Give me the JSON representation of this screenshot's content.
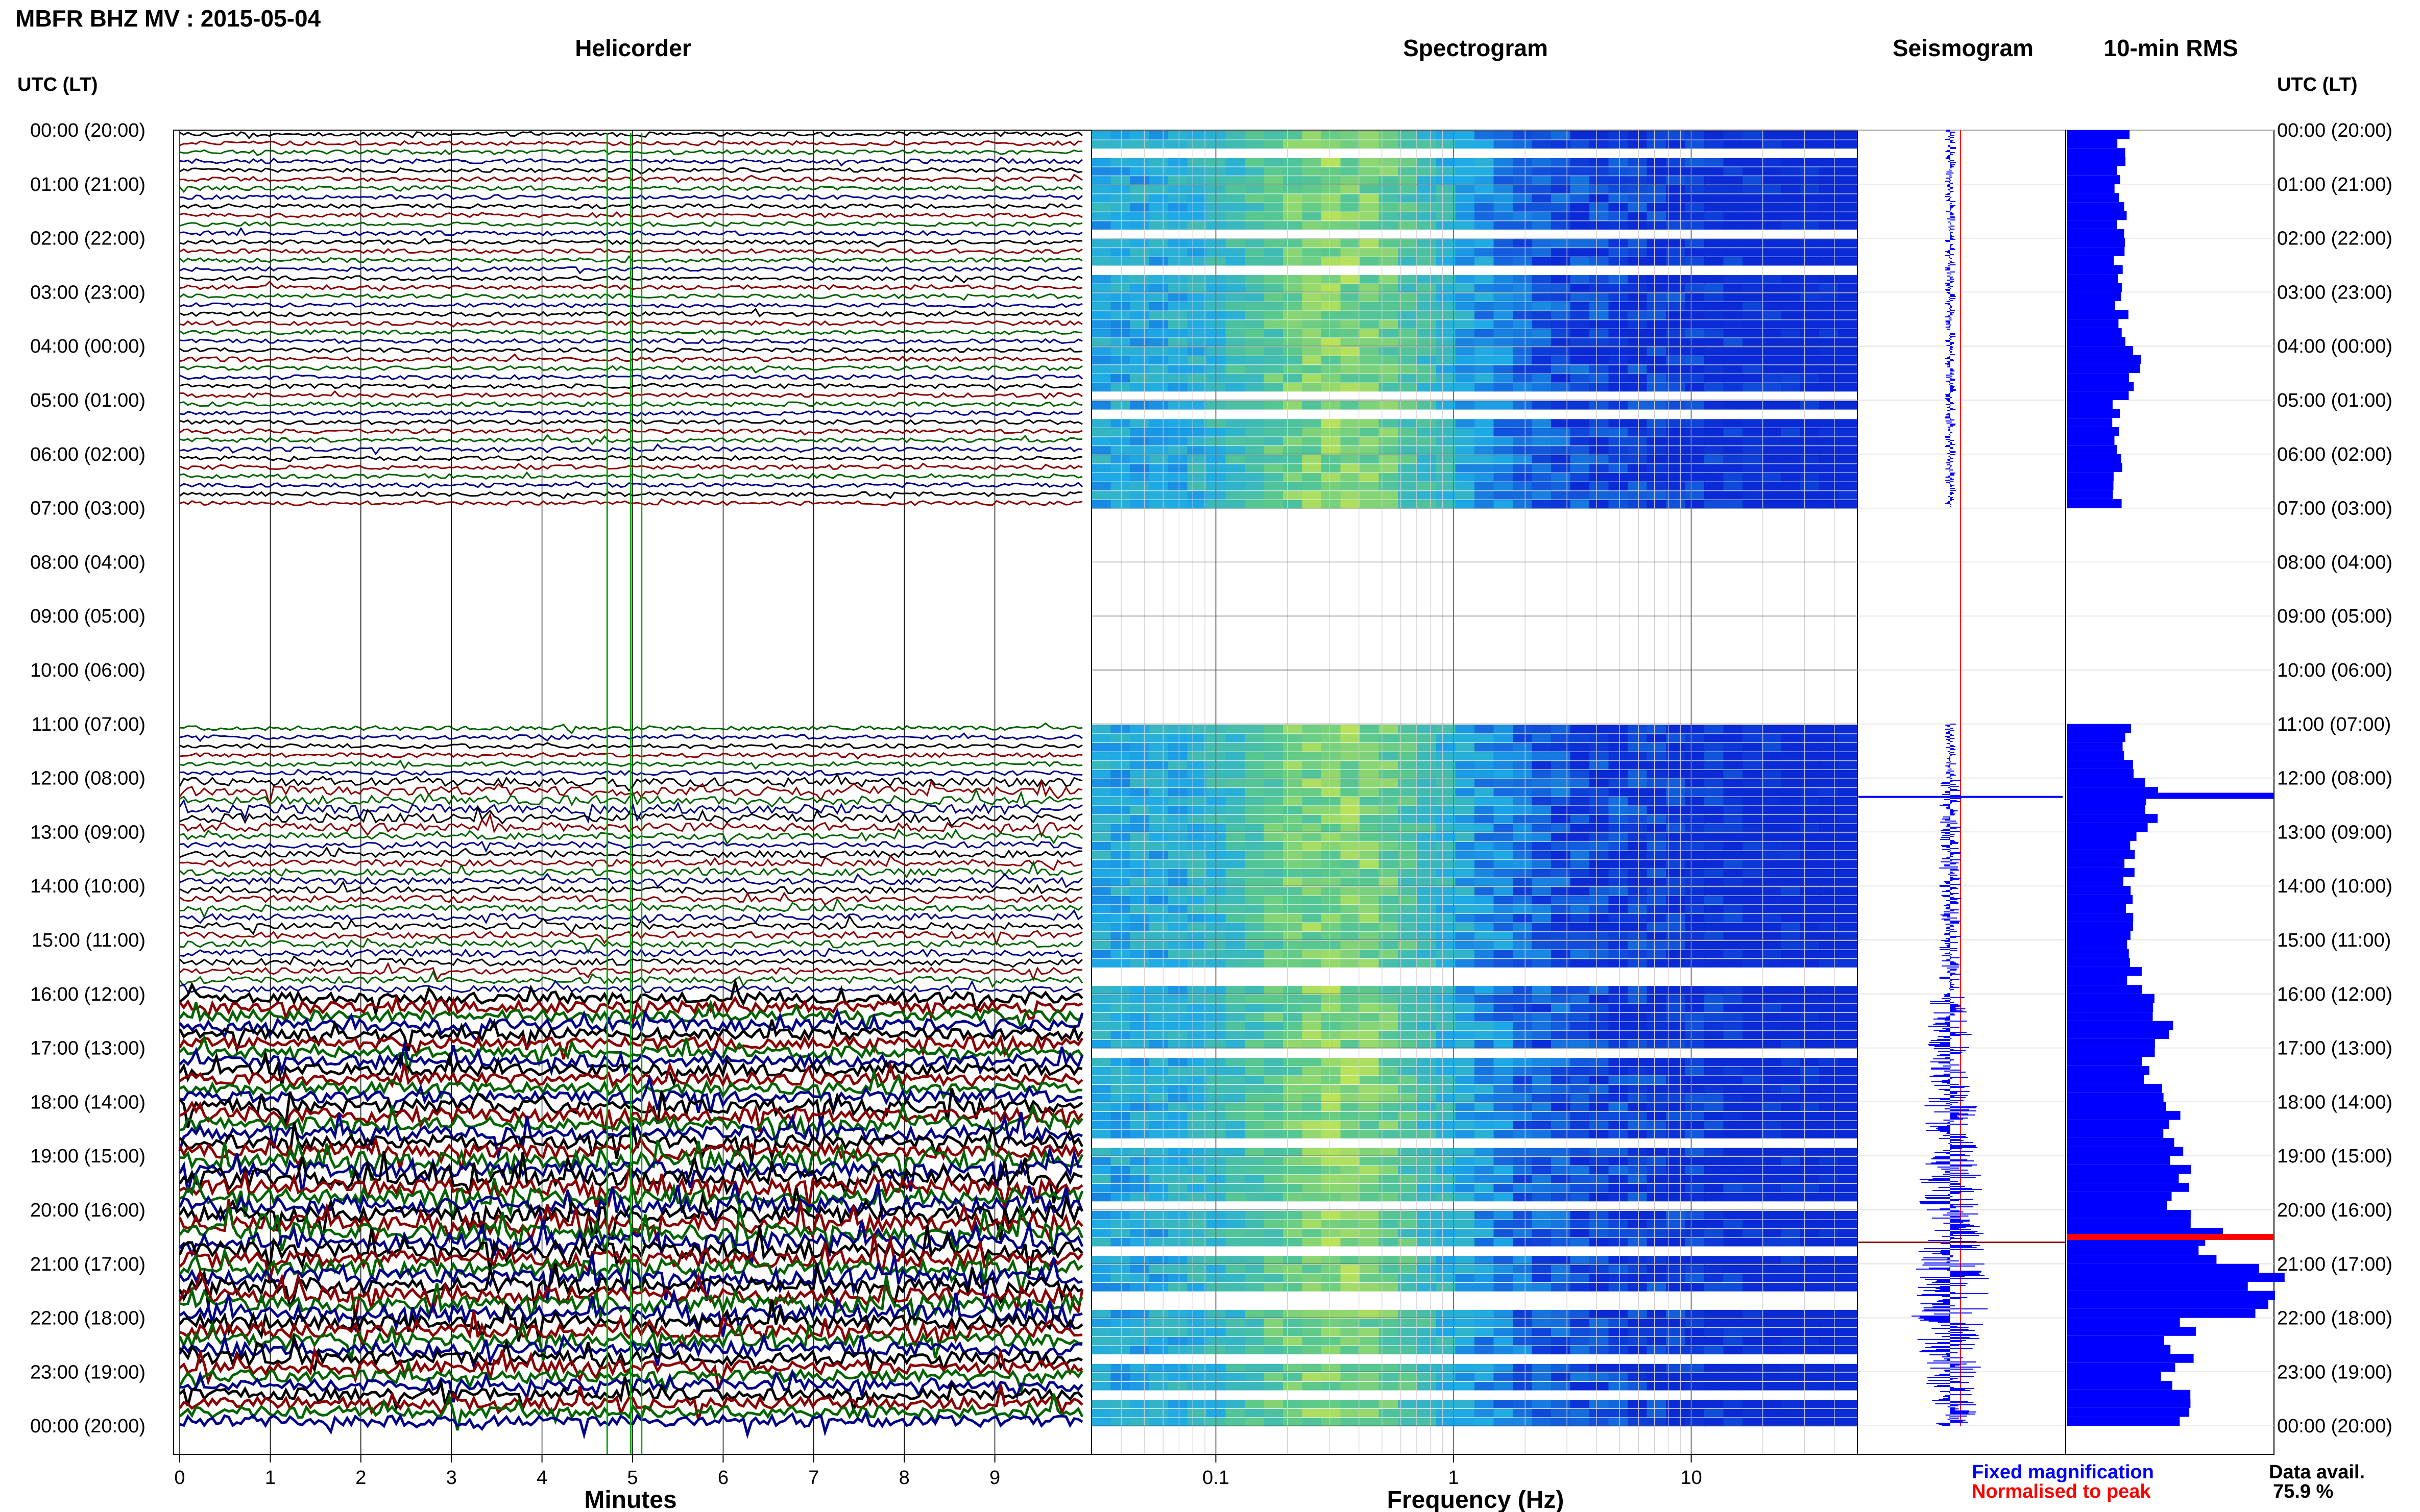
{
  "header": {
    "title": "MBFR BHZ MV : 2015-05-04"
  },
  "panels": {
    "helicorder": "Helicorder",
    "spectrogram": "Spectrogram",
    "seismogram": "Seismogram",
    "rms": "10-min RMS"
  },
  "axis_labels": {
    "time_left": "UTC (LT)",
    "time_right": "UTC (LT)",
    "minutes": "Minutes",
    "frequency": "Frequency (Hz)"
  },
  "legend": {
    "fixed": "Fixed magnification",
    "normalised": "Normalised to peak",
    "availability_label": "Data avail.",
    "availability_value": "75.9 %"
  },
  "colors": {
    "fixed": "#0000ff",
    "normalised": "#ff0000",
    "trace_colors": [
      "#000000",
      "#8b0000",
      "#006400",
      "#00008b"
    ],
    "spectro_low": "#0a2ad6",
    "spectro_high": "#f2f23c"
  },
  "chart_data": [
    {
      "type": "line",
      "panel": "Helicorder",
      "xlabel": "Minutes",
      "x_ticks": [
        "0",
        "1",
        "2",
        "3",
        "4",
        "5",
        "6",
        "7",
        "8",
        "9"
      ],
      "xlim": [
        0,
        10
      ],
      "y_ticks": [
        "00:00 (20:00)",
        "01:00 (21:00)",
        "02:00 (22:00)",
        "03:00 (23:00)",
        "04:00 (00:00)",
        "05:00 (01:00)",
        "06:00 (02:00)",
        "07:00 (03:00)",
        "08:00 (04:00)",
        "09:00 (05:00)",
        "10:00 (06:00)",
        "11:00 (07:00)",
        "12:00 (08:00)",
        "13:00 (09:00)",
        "14:00 (10:00)",
        "15:00 (11:00)",
        "16:00 (12:00)",
        "17:00 (13:00)",
        "18:00 (14:00)",
        "19:00 (15:00)",
        "20:00 (16:00)",
        "21:00 (17:00)",
        "22:00 (18:00)",
        "23:00 (19:00)",
        "00:00 (20:00)"
      ],
      "data_gap_hours": [
        7,
        11
      ],
      "amplitude_by_hour": [
        1,
        1,
        1,
        1,
        1,
        1,
        1,
        0,
        0,
        0,
        0,
        1,
        3,
        2,
        2,
        2,
        4,
        4,
        5,
        6,
        6,
        6,
        5,
        4
      ]
    },
    {
      "type": "heatmap",
      "panel": "Spectrogram",
      "xlabel": "Frequency (Hz)",
      "x_scale": "log",
      "x_ticks": [
        "0.1",
        "1",
        "10"
      ],
      "xlim": [
        0.03,
        50
      ],
      "peak_band_hz": [
        0.2,
        0.5
      ],
      "data_gap_hours": [
        7,
        11
      ]
    },
    {
      "type": "line",
      "panel": "Seismogram",
      "envelope_by_hour": [
        1,
        1,
        1,
        1,
        1,
        1,
        1,
        0,
        0,
        0,
        0,
        1,
        2,
        2,
        2,
        2,
        4,
        4,
        5,
        6,
        6,
        7,
        6,
        5
      ]
    },
    {
      "type": "bar",
      "panel": "10-min RMS",
      "values_by_hour": [
        2.7,
        2.6,
        2.6,
        2.7,
        3.2,
        2.4,
        2.4,
        0,
        0,
        0,
        0,
        3.2,
        4.2,
        3.0,
        3.1,
        3.3,
        4.8,
        4.2,
        5.0,
        5.5,
        7.0,
        9.8,
        5.6,
        5.3
      ],
      "peak_markers_hour": [
        12.33,
        20.5
      ]
    }
  ]
}
